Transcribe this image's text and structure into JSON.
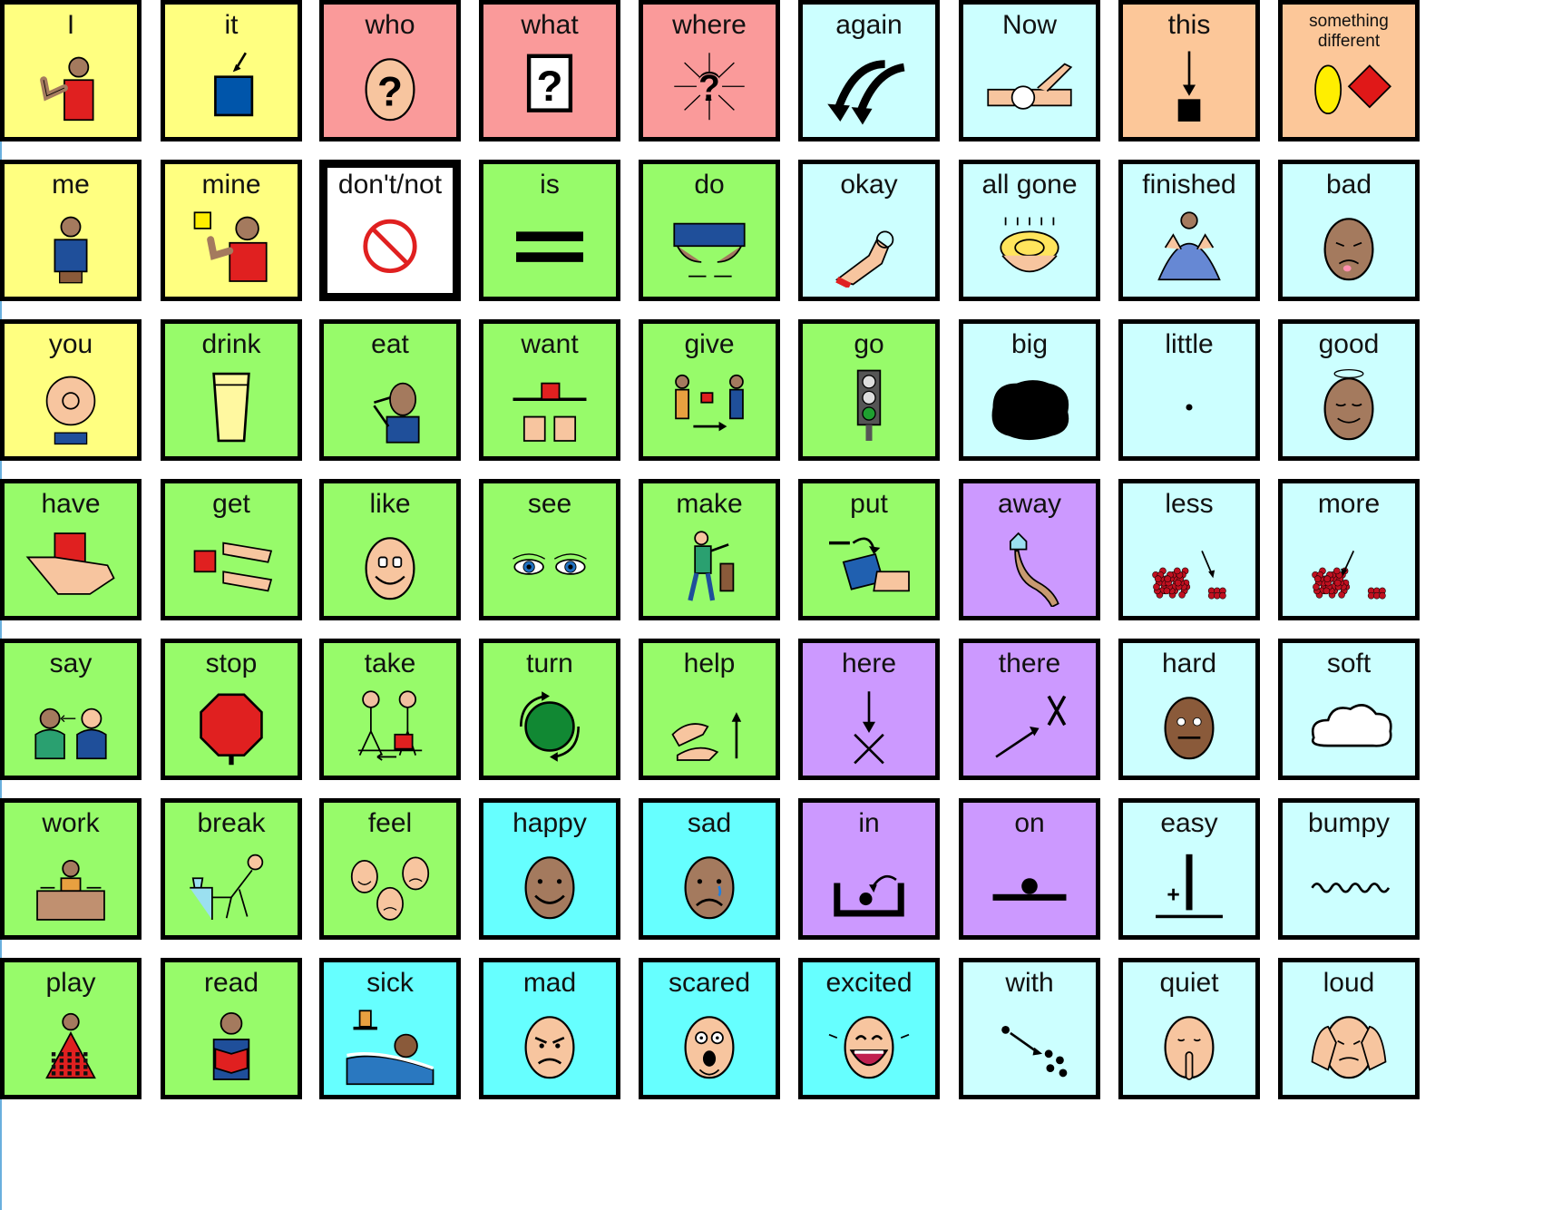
{
  "colors": {
    "yellow": "#ffff80",
    "green": "#97fb6a",
    "pink": "#fa9a9a",
    "lightblue": "#ccffff",
    "orange": "#fcc799",
    "purple": "#cc99ff",
    "cyan": "#66ffff",
    "white": "#ffffff"
  },
  "grid": [
    [
      {
        "label": "I",
        "color": "yellow",
        "icon": "point-self-icon"
      },
      {
        "label": "it",
        "color": "yellow",
        "icon": "blue-square-arrow-icon"
      },
      {
        "label": "who",
        "color": "pink",
        "icon": "head-question-icon"
      },
      {
        "label": "what",
        "color": "pink",
        "icon": "box-question-icon"
      },
      {
        "label": "where",
        "color": "pink",
        "icon": "question-arrows-icon"
      },
      {
        "label": "again",
        "color": "lightblue",
        "icon": "curved-arrows-icon"
      },
      {
        "label": "Now",
        "color": "lightblue",
        "icon": "wristwatch-icon"
      },
      {
        "label": "this",
        "color": "orange",
        "icon": "arrow-down-square-icon"
      },
      {
        "label": "something different",
        "color": "orange",
        "icon": "oval-diamond-icon",
        "small": true
      }
    ],
    [
      {
        "label": "me",
        "color": "yellow",
        "icon": "person-self-icon"
      },
      {
        "label": "mine",
        "color": "yellow",
        "icon": "person-square-icon"
      },
      {
        "label": "don't/not",
        "color": "white",
        "icon": "prohibited-icon",
        "thick": true
      },
      {
        "label": "is",
        "color": "green",
        "icon": "equals-icon"
      },
      {
        "label": "do",
        "color": "green",
        "icon": "hands-do-icon"
      },
      {
        "label": "okay",
        "color": "lightblue",
        "icon": "ok-hand-icon"
      },
      {
        "label": "all gone",
        "color": "lightblue",
        "icon": "empty-bowl-icon"
      },
      {
        "label": "finished",
        "color": "lightblue",
        "icon": "finished-hands-icon"
      },
      {
        "label": "bad",
        "color": "lightblue",
        "icon": "bad-face-icon"
      }
    ],
    [
      {
        "label": "you",
        "color": "yellow",
        "icon": "pointing-hand-icon"
      },
      {
        "label": "drink",
        "color": "green",
        "icon": "glass-icon"
      },
      {
        "label": "eat",
        "color": "green",
        "icon": "person-eating-icon"
      },
      {
        "label": "want",
        "color": "green",
        "icon": "reaching-hands-icon"
      },
      {
        "label": "give",
        "color": "green",
        "icon": "people-giving-icon"
      },
      {
        "label": "go",
        "color": "green",
        "icon": "traffic-light-icon"
      },
      {
        "label": "big",
        "color": "lightblue",
        "icon": "big-blob-icon"
      },
      {
        "label": "little",
        "color": "lightblue",
        "icon": "small-dot-icon"
      },
      {
        "label": "good",
        "color": "lightblue",
        "icon": "halo-face-icon"
      }
    ],
    [
      {
        "label": "have",
        "color": "green",
        "icon": "hand-holding-box-icon"
      },
      {
        "label": "get",
        "color": "green",
        "icon": "hands-reaching-icon"
      },
      {
        "label": "like",
        "color": "green",
        "icon": "smiling-face-icon"
      },
      {
        "label": "see",
        "color": "green",
        "icon": "eyes-icon"
      },
      {
        "label": "make",
        "color": "green",
        "icon": "person-hammering-icon"
      },
      {
        "label": "put",
        "color": "green",
        "icon": "hand-placing-icon"
      },
      {
        "label": "away",
        "color": "purple",
        "icon": "house-path-icon"
      },
      {
        "label": "less",
        "color": "lightblue",
        "icon": "berries-less-icon"
      },
      {
        "label": "more",
        "color": "lightblue",
        "icon": "berries-more-icon"
      }
    ],
    [
      {
        "label": "say",
        "color": "green",
        "icon": "people-talking-icon"
      },
      {
        "label": "stop",
        "color": "green",
        "icon": "stop-sign-icon"
      },
      {
        "label": "take",
        "color": "green",
        "icon": "stick-people-take-icon"
      },
      {
        "label": "turn",
        "color": "green",
        "icon": "rotating-circle-icon"
      },
      {
        "label": "help",
        "color": "green",
        "icon": "helping-hands-icon"
      },
      {
        "label": "here",
        "color": "purple",
        "icon": "arrow-to-x-icon"
      },
      {
        "label": "there",
        "color": "purple",
        "icon": "arrow-toward-x-icon"
      },
      {
        "label": "hard",
        "color": "lightblue",
        "icon": "straining-person-icon"
      },
      {
        "label": "soft",
        "color": "lightblue",
        "icon": "cloud-icon"
      }
    ],
    [
      {
        "label": "work",
        "color": "green",
        "icon": "person-desk-icon"
      },
      {
        "label": "break",
        "color": "green",
        "icon": "person-relaxing-icon"
      },
      {
        "label": "feel",
        "color": "green",
        "icon": "three-faces-icon"
      },
      {
        "label": "happy",
        "color": "cyan",
        "icon": "happy-face-icon"
      },
      {
        "label": "sad",
        "color": "cyan",
        "icon": "sad-face-icon"
      },
      {
        "label": "in",
        "color": "purple",
        "icon": "ball-in-box-icon"
      },
      {
        "label": "on",
        "color": "purple",
        "icon": "ball-on-line-icon"
      },
      {
        "label": "easy",
        "color": "lightblue",
        "icon": "easy-math-icon"
      },
      {
        "label": "bumpy",
        "color": "lightblue",
        "icon": "wavy-line-icon"
      }
    ],
    [
      {
        "label": "play",
        "color": "green",
        "icon": "person-blocks-icon"
      },
      {
        "label": "read",
        "color": "green",
        "icon": "person-reading-icon"
      },
      {
        "label": "sick",
        "color": "cyan",
        "icon": "person-in-bed-icon"
      },
      {
        "label": "mad",
        "color": "cyan",
        "icon": "mad-face-icon"
      },
      {
        "label": "scared",
        "color": "cyan",
        "icon": "scared-face-icon"
      },
      {
        "label": "excited",
        "color": "cyan",
        "icon": "excited-face-icon"
      },
      {
        "label": "with",
        "color": "lightblue",
        "icon": "dot-with-dots-icon"
      },
      {
        "label": "quiet",
        "color": "lightblue",
        "icon": "shush-face-icon"
      },
      {
        "label": "loud",
        "color": "lightblue",
        "icon": "covering-ears-icon"
      }
    ]
  ]
}
